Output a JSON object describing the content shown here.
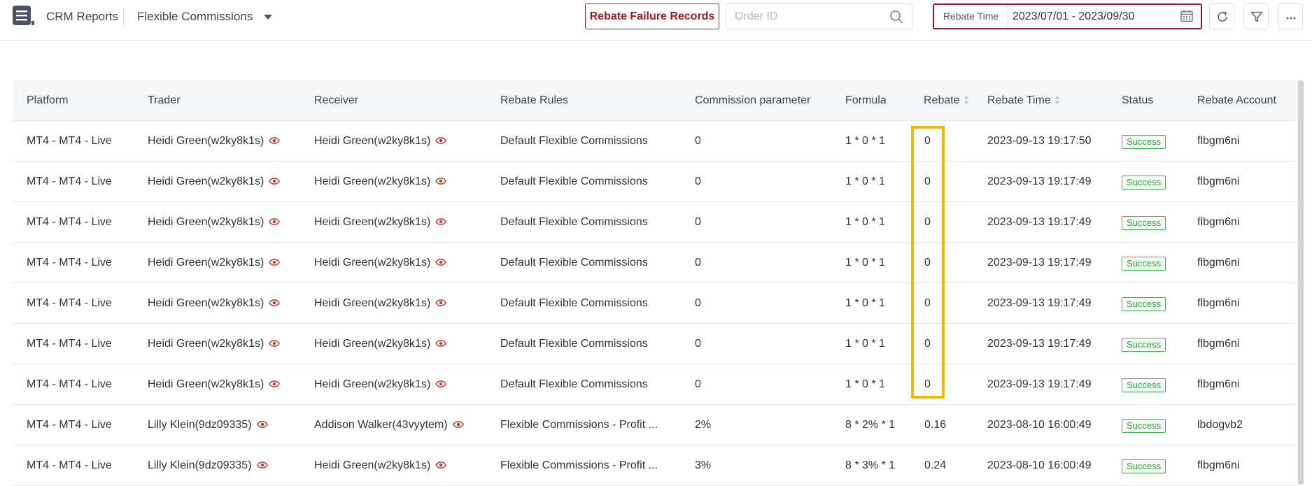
{
  "header": {
    "app_name": "CRM Reports",
    "module_name": "Flexible Commissions",
    "rebate_failure_button": "Rebate Failure Records",
    "order_id_placeholder": "Order ID",
    "date_filter_label": "Rebate Time",
    "date_range": "2023/07/01 - 2023/09/30"
  },
  "table": {
    "columns": [
      "Platform",
      "Trader",
      "Receiver",
      "Rebate Rules",
      "Commission parameter",
      "Formula",
      "Rebate",
      "Rebate Time",
      "Status",
      "Rebate Account"
    ],
    "rows": [
      {
        "platform": "MT4 - MT4 - Live",
        "trader": "Heidi Green(w2ky8k1s)",
        "receiver": "Heidi Green(w2ky8k1s)",
        "rule": "Default Flexible Commissions",
        "param": "0",
        "formula": "1 * 0 * 1",
        "rebate": "0",
        "time": "2023-09-13 19:17:50",
        "status": "Success",
        "account": "flbgm6ni"
      },
      {
        "platform": "MT4 - MT4 - Live",
        "trader": "Heidi Green(w2ky8k1s)",
        "receiver": "Heidi Green(w2ky8k1s)",
        "rule": "Default Flexible Commissions",
        "param": "0",
        "formula": "1 * 0 * 1",
        "rebate": "0",
        "time": "2023-09-13 19:17:49",
        "status": "Success",
        "account": "flbgm6ni"
      },
      {
        "platform": "MT4 - MT4 - Live",
        "trader": "Heidi Green(w2ky8k1s)",
        "receiver": "Heidi Green(w2ky8k1s)",
        "rule": "Default Flexible Commissions",
        "param": "0",
        "formula": "1 * 0 * 1",
        "rebate": "0",
        "time": "2023-09-13 19:17:49",
        "status": "Success",
        "account": "flbgm6ni"
      },
      {
        "platform": "MT4 - MT4 - Live",
        "trader": "Heidi Green(w2ky8k1s)",
        "receiver": "Heidi Green(w2ky8k1s)",
        "rule": "Default Flexible Commissions",
        "param": "0",
        "formula": "1 * 0 * 1",
        "rebate": "0",
        "time": "2023-09-13 19:17:49",
        "status": "Success",
        "account": "flbgm6ni"
      },
      {
        "platform": "MT4 - MT4 - Live",
        "trader": "Heidi Green(w2ky8k1s)",
        "receiver": "Heidi Green(w2ky8k1s)",
        "rule": "Default Flexible Commissions",
        "param": "0",
        "formula": "1 * 0 * 1",
        "rebate": "0",
        "time": "2023-09-13 19:17:49",
        "status": "Success",
        "account": "flbgm6ni"
      },
      {
        "platform": "MT4 - MT4 - Live",
        "trader": "Heidi Green(w2ky8k1s)",
        "receiver": "Heidi Green(w2ky8k1s)",
        "rule": "Default Flexible Commissions",
        "param": "0",
        "formula": "1 * 0 * 1",
        "rebate": "0",
        "time": "2023-09-13 19:17:49",
        "status": "Success",
        "account": "flbgm6ni"
      },
      {
        "platform": "MT4 - MT4 - Live",
        "trader": "Heidi Green(w2ky8k1s)",
        "receiver": "Heidi Green(w2ky8k1s)",
        "rule": "Default Flexible Commissions",
        "param": "0",
        "formula": "1 * 0 * 1",
        "rebate": "0",
        "time": "2023-09-13 19:17:49",
        "status": "Success",
        "account": "flbgm6ni"
      },
      {
        "platform": "MT4 - MT4 - Live",
        "trader": "Lilly Klein(9dz09335)",
        "receiver": "Addison Walker(43vyytem)",
        "rule": "Flexible Commissions - Profit ...",
        "param": "2%",
        "formula": "8 * 2% * 1",
        "rebate": "0.16",
        "time": "2023-08-10 16:00:49",
        "status": "Success",
        "account": "lbdogvb2"
      },
      {
        "platform": "MT4 - MT4 - Live",
        "trader": "Lilly Klein(9dz09335)",
        "receiver": "Heidi Green(w2ky8k1s)",
        "rule": "Flexible Commissions - Profit ...",
        "param": "3%",
        "formula": "8 * 3% * 1",
        "rebate": "0.24",
        "time": "2023-08-10 16:00:49",
        "status": "Success",
        "account": "flbgm6ni"
      }
    ]
  },
  "colors": {
    "brand": "#9b1b21",
    "success": "#2fa23c",
    "highlight": "#f5b800",
    "eye_icon": "#c0392b"
  }
}
